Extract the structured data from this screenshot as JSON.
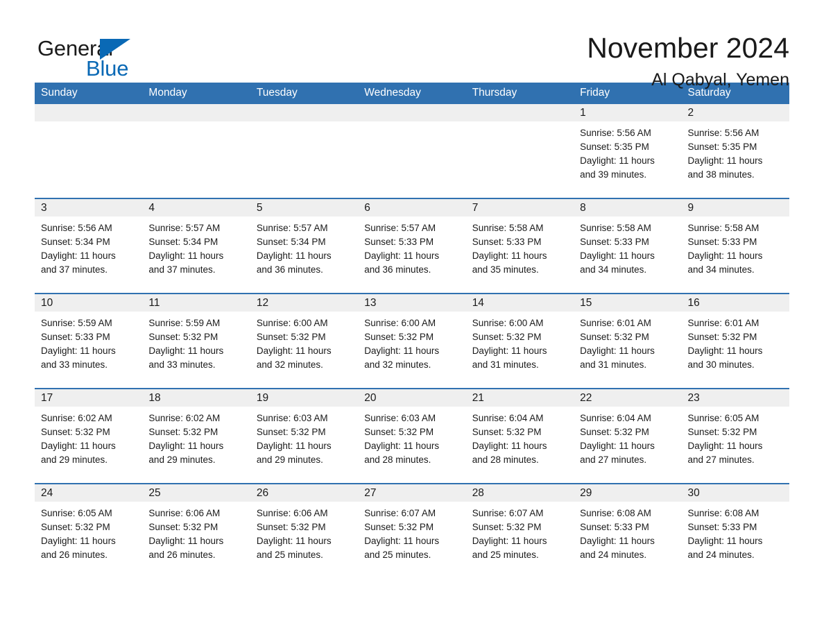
{
  "brand": {
    "name_part1": "General",
    "name_part2": "Blue",
    "triangle_color": "#0a69b5",
    "blue_color": "#0a69b5"
  },
  "header": {
    "title": "November 2024",
    "subtitle": "Al Qabyal, Yemen"
  },
  "theme": {
    "header_blue": "#3071b0",
    "daynum_gray": "#efefef",
    "text": "#1a1a1a"
  },
  "weekday_headers": [
    "Sunday",
    "Monday",
    "Tuesday",
    "Wednesday",
    "Thursday",
    "Friday",
    "Saturday"
  ],
  "weeks": [
    [
      {
        "day": "",
        "blank": true,
        "sunrise": "",
        "sunset": "",
        "daylight_line1": "",
        "daylight_line2": ""
      },
      {
        "day": "",
        "blank": true,
        "sunrise": "",
        "sunset": "",
        "daylight_line1": "",
        "daylight_line2": ""
      },
      {
        "day": "",
        "blank": true,
        "sunrise": "",
        "sunset": "",
        "daylight_line1": "",
        "daylight_line2": ""
      },
      {
        "day": "",
        "blank": true,
        "sunrise": "",
        "sunset": "",
        "daylight_line1": "",
        "daylight_line2": ""
      },
      {
        "day": "",
        "blank": true,
        "sunrise": "",
        "sunset": "",
        "daylight_line1": "",
        "daylight_line2": ""
      },
      {
        "day": "1",
        "blank": false,
        "sunrise": "Sunrise: 5:56 AM",
        "sunset": "Sunset: 5:35 PM",
        "daylight_line1": "Daylight: 11 hours",
        "daylight_line2": "and 39 minutes."
      },
      {
        "day": "2",
        "blank": false,
        "sunrise": "Sunrise: 5:56 AM",
        "sunset": "Sunset: 5:35 PM",
        "daylight_line1": "Daylight: 11 hours",
        "daylight_line2": "and 38 minutes."
      }
    ],
    [
      {
        "day": "3",
        "blank": false,
        "sunrise": "Sunrise: 5:56 AM",
        "sunset": "Sunset: 5:34 PM",
        "daylight_line1": "Daylight: 11 hours",
        "daylight_line2": "and 37 minutes."
      },
      {
        "day": "4",
        "blank": false,
        "sunrise": "Sunrise: 5:57 AM",
        "sunset": "Sunset: 5:34 PM",
        "daylight_line1": "Daylight: 11 hours",
        "daylight_line2": "and 37 minutes."
      },
      {
        "day": "5",
        "blank": false,
        "sunrise": "Sunrise: 5:57 AM",
        "sunset": "Sunset: 5:34 PM",
        "daylight_line1": "Daylight: 11 hours",
        "daylight_line2": "and 36 minutes."
      },
      {
        "day": "6",
        "blank": false,
        "sunrise": "Sunrise: 5:57 AM",
        "sunset": "Sunset: 5:33 PM",
        "daylight_line1": "Daylight: 11 hours",
        "daylight_line2": "and 36 minutes."
      },
      {
        "day": "7",
        "blank": false,
        "sunrise": "Sunrise: 5:58 AM",
        "sunset": "Sunset: 5:33 PM",
        "daylight_line1": "Daylight: 11 hours",
        "daylight_line2": "and 35 minutes."
      },
      {
        "day": "8",
        "blank": false,
        "sunrise": "Sunrise: 5:58 AM",
        "sunset": "Sunset: 5:33 PM",
        "daylight_line1": "Daylight: 11 hours",
        "daylight_line2": "and 34 minutes."
      },
      {
        "day": "9",
        "blank": false,
        "sunrise": "Sunrise: 5:58 AM",
        "sunset": "Sunset: 5:33 PM",
        "daylight_line1": "Daylight: 11 hours",
        "daylight_line2": "and 34 minutes."
      }
    ],
    [
      {
        "day": "10",
        "blank": false,
        "sunrise": "Sunrise: 5:59 AM",
        "sunset": "Sunset: 5:33 PM",
        "daylight_line1": "Daylight: 11 hours",
        "daylight_line2": "and 33 minutes."
      },
      {
        "day": "11",
        "blank": false,
        "sunrise": "Sunrise: 5:59 AM",
        "sunset": "Sunset: 5:32 PM",
        "daylight_line1": "Daylight: 11 hours",
        "daylight_line2": "and 33 minutes."
      },
      {
        "day": "12",
        "blank": false,
        "sunrise": "Sunrise: 6:00 AM",
        "sunset": "Sunset: 5:32 PM",
        "daylight_line1": "Daylight: 11 hours",
        "daylight_line2": "and 32 minutes."
      },
      {
        "day": "13",
        "blank": false,
        "sunrise": "Sunrise: 6:00 AM",
        "sunset": "Sunset: 5:32 PM",
        "daylight_line1": "Daylight: 11 hours",
        "daylight_line2": "and 32 minutes."
      },
      {
        "day": "14",
        "blank": false,
        "sunrise": "Sunrise: 6:00 AM",
        "sunset": "Sunset: 5:32 PM",
        "daylight_line1": "Daylight: 11 hours",
        "daylight_line2": "and 31 minutes."
      },
      {
        "day": "15",
        "blank": false,
        "sunrise": "Sunrise: 6:01 AM",
        "sunset": "Sunset: 5:32 PM",
        "daylight_line1": "Daylight: 11 hours",
        "daylight_line2": "and 31 minutes."
      },
      {
        "day": "16",
        "blank": false,
        "sunrise": "Sunrise: 6:01 AM",
        "sunset": "Sunset: 5:32 PM",
        "daylight_line1": "Daylight: 11 hours",
        "daylight_line2": "and 30 minutes."
      }
    ],
    [
      {
        "day": "17",
        "blank": false,
        "sunrise": "Sunrise: 6:02 AM",
        "sunset": "Sunset: 5:32 PM",
        "daylight_line1": "Daylight: 11 hours",
        "daylight_line2": "and 29 minutes."
      },
      {
        "day": "18",
        "blank": false,
        "sunrise": "Sunrise: 6:02 AM",
        "sunset": "Sunset: 5:32 PM",
        "daylight_line1": "Daylight: 11 hours",
        "daylight_line2": "and 29 minutes."
      },
      {
        "day": "19",
        "blank": false,
        "sunrise": "Sunrise: 6:03 AM",
        "sunset": "Sunset: 5:32 PM",
        "daylight_line1": "Daylight: 11 hours",
        "daylight_line2": "and 29 minutes."
      },
      {
        "day": "20",
        "blank": false,
        "sunrise": "Sunrise: 6:03 AM",
        "sunset": "Sunset: 5:32 PM",
        "daylight_line1": "Daylight: 11 hours",
        "daylight_line2": "and 28 minutes."
      },
      {
        "day": "21",
        "blank": false,
        "sunrise": "Sunrise: 6:04 AM",
        "sunset": "Sunset: 5:32 PM",
        "daylight_line1": "Daylight: 11 hours",
        "daylight_line2": "and 28 minutes."
      },
      {
        "day": "22",
        "blank": false,
        "sunrise": "Sunrise: 6:04 AM",
        "sunset": "Sunset: 5:32 PM",
        "daylight_line1": "Daylight: 11 hours",
        "daylight_line2": "and 27 minutes."
      },
      {
        "day": "23",
        "blank": false,
        "sunrise": "Sunrise: 6:05 AM",
        "sunset": "Sunset: 5:32 PM",
        "daylight_line1": "Daylight: 11 hours",
        "daylight_line2": "and 27 minutes."
      }
    ],
    [
      {
        "day": "24",
        "blank": false,
        "sunrise": "Sunrise: 6:05 AM",
        "sunset": "Sunset: 5:32 PM",
        "daylight_line1": "Daylight: 11 hours",
        "daylight_line2": "and 26 minutes."
      },
      {
        "day": "25",
        "blank": false,
        "sunrise": "Sunrise: 6:06 AM",
        "sunset": "Sunset: 5:32 PM",
        "daylight_line1": "Daylight: 11 hours",
        "daylight_line2": "and 26 minutes."
      },
      {
        "day": "26",
        "blank": false,
        "sunrise": "Sunrise: 6:06 AM",
        "sunset": "Sunset: 5:32 PM",
        "daylight_line1": "Daylight: 11 hours",
        "daylight_line2": "and 25 minutes."
      },
      {
        "day": "27",
        "blank": false,
        "sunrise": "Sunrise: 6:07 AM",
        "sunset": "Sunset: 5:32 PM",
        "daylight_line1": "Daylight: 11 hours",
        "daylight_line2": "and 25 minutes."
      },
      {
        "day": "28",
        "blank": false,
        "sunrise": "Sunrise: 6:07 AM",
        "sunset": "Sunset: 5:32 PM",
        "daylight_line1": "Daylight: 11 hours",
        "daylight_line2": "and 25 minutes."
      },
      {
        "day": "29",
        "blank": false,
        "sunrise": "Sunrise: 6:08 AM",
        "sunset": "Sunset: 5:33 PM",
        "daylight_line1": "Daylight: 11 hours",
        "daylight_line2": "and 24 minutes."
      },
      {
        "day": "30",
        "blank": false,
        "sunrise": "Sunrise: 6:08 AM",
        "sunset": "Sunset: 5:33 PM",
        "daylight_line1": "Daylight: 11 hours",
        "daylight_line2": "and 24 minutes."
      }
    ]
  ]
}
